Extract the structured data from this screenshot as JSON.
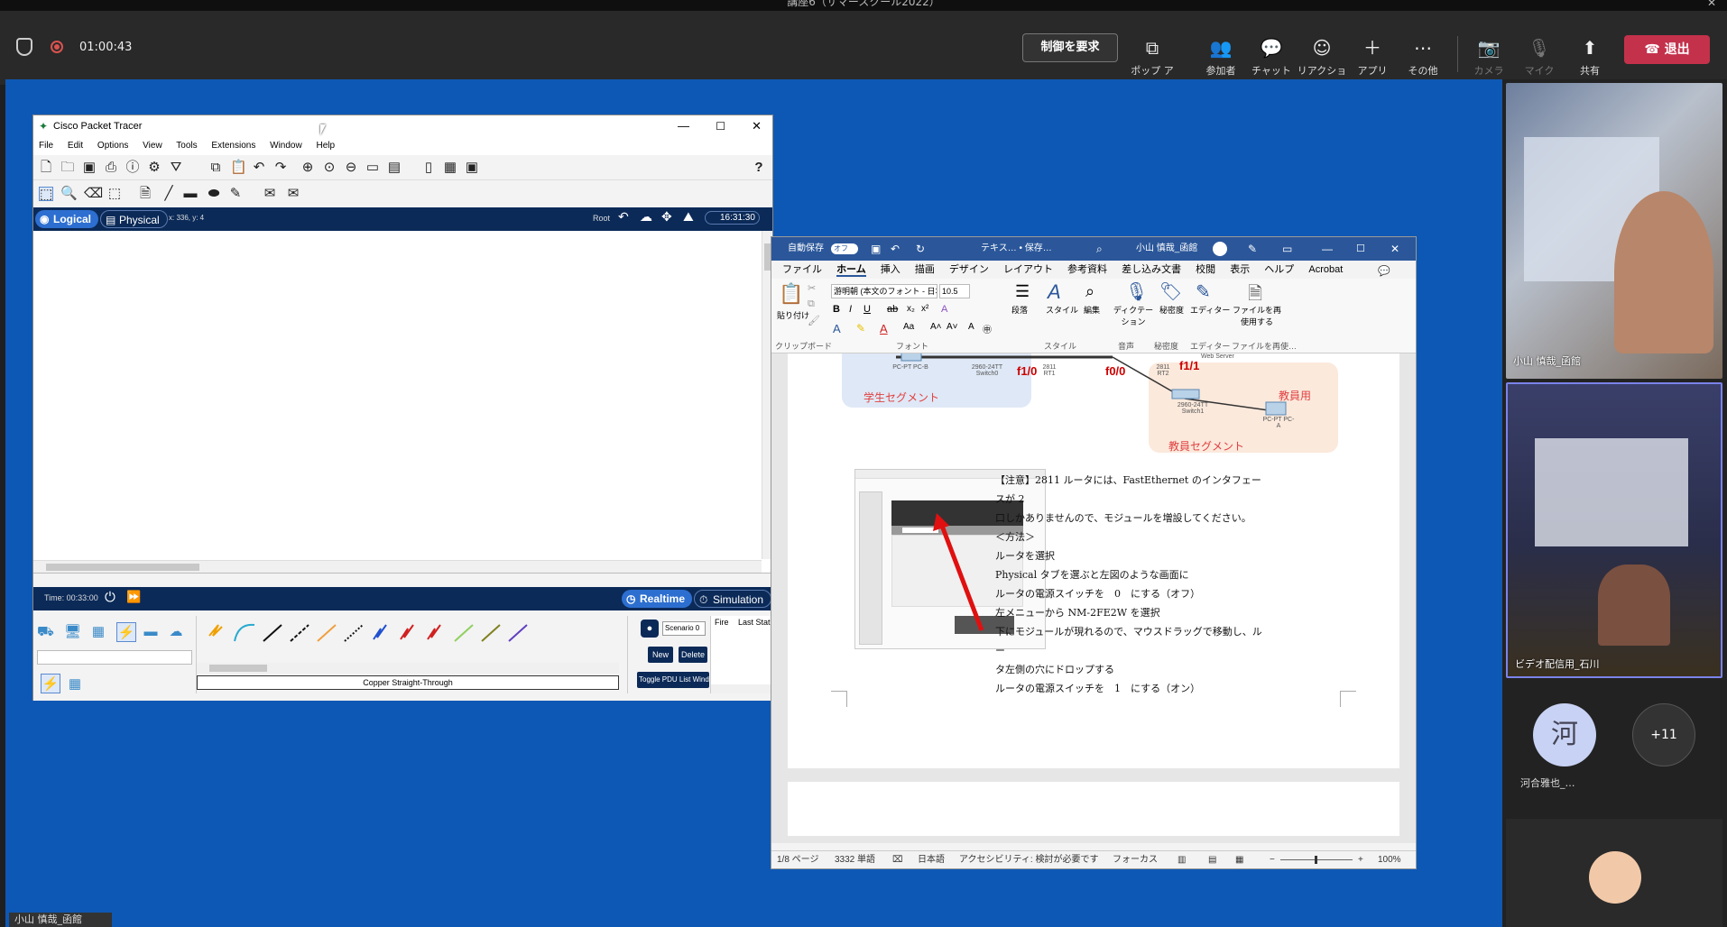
{
  "window_title": "講座6（サマースクール2022）",
  "teams": {
    "timer": "01:00:43",
    "request_control": "制御を要求",
    "buttons": [
      {
        "label": "ポップ アウト",
        "icon": "popout-icon"
      },
      {
        "label": "参加者",
        "icon": "people-icon"
      },
      {
        "label": "チャット",
        "icon": "chat-icon"
      },
      {
        "label": "リアクション",
        "icon": "reaction-icon"
      },
      {
        "label": "アプリ",
        "icon": "plus-icon"
      },
      {
        "label": "その他",
        "icon": "more-icon"
      },
      {
        "label": "カメラ",
        "icon": "camera-off-icon"
      },
      {
        "label": "マイク",
        "icon": "mic-off-icon"
      },
      {
        "label": "共有",
        "icon": "share-icon"
      }
    ],
    "leave": "退出",
    "bottom_label": "小山 慎哉_函館"
  },
  "participants": {
    "tile1_name": "小山 慎哉_函館",
    "tile2_name": "ビデオ配信用_石川",
    "avatar_initial": "河",
    "avatar_name": "河合雅也_…",
    "more_count": "+11"
  },
  "packet_tracer": {
    "title": "Cisco Packet Tracer",
    "menu": [
      "File",
      "Edit",
      "Options",
      "View",
      "Tools",
      "Extensions",
      "Window",
      "Help"
    ],
    "logical": "Logical",
    "physical": "Physical",
    "coords": "x: 336, y: 4",
    "root": "Root",
    "clock": "16:31:30",
    "time": "Time: 00:33:00",
    "realtime": "Realtime",
    "simulation": "Simulation",
    "scenario": "Scenario 0",
    "new": "New",
    "delete": "Delete",
    "toggle_pdu": "Toggle PDU List Window",
    "fire": "Fire",
    "last_status": "Last Status",
    "cable_label": "Copper Straight-Through",
    "help": "?"
  },
  "word": {
    "autosave": "自動保存",
    "autosave_state": "オフ",
    "doc_name": "テキス… • 保存…",
    "user": "小山 慎哉_函館",
    "tabs": [
      "ファイル",
      "ホーム",
      "挿入",
      "描画",
      "デザイン",
      "レイアウト",
      "参考資料",
      "差し込み文書",
      "校閲",
      "表示",
      "ヘルプ",
      "Acrobat"
    ],
    "font_name": "游明朝 (本文のフォント - 日本",
    "font_size": "10.5",
    "groups": [
      "クリップボード",
      "フォント",
      "スタイル",
      "音声",
      "秘密度",
      "エディター",
      "ファイルを再使…"
    ],
    "ribbon_buttons": [
      "貼り付け",
      "段落",
      "スタイル",
      "編集",
      "ディクテーション",
      "秘密度",
      "エディター",
      "ファイルを再使用する"
    ],
    "diagram": {
      "pc_b": "PC-PT PC-B",
      "switch0": "2960-24TT Switch0",
      "rt1": "2811 RT1",
      "rt2": "2811 RT2",
      "f10": "f1/0",
      "f00": "f0/0",
      "f11": "f1/1",
      "web": "Web Server",
      "switch1": "2960-24TT Switch1",
      "pc_a": "PC-PT PC-A",
      "student_seg": "学生セグメント",
      "teacher_label": "教員用",
      "teacher_seg": "教員セグメント"
    },
    "body_lines": [
      "【注意】2811 ルータには、FastEthernet のインタフェースが 2",
      "口しかありませんので、モジュールを増設してください。",
      "＜方法＞",
      "ルータを選択",
      "Physical タブを選ぶと左図のような画面に",
      "ルータの電源スイッチを　0　にする（オフ）",
      "左メニューから NM-2FE2W を選択",
      "下にモジュールが現れるので、マウスドラッグで移動し、ルー",
      "タ左側の穴にドロップする",
      "ルータの電源スイッチを　1　にする（オン）"
    ],
    "status": {
      "page": "1/8 ページ",
      "words": "3332 単語",
      "lang": "日本語",
      "access": "アクセシビリティ: 検討が必要です",
      "focus": "フォーカス",
      "zoom": "100%"
    }
  },
  "colors": {
    "leave": "#c4314b",
    "stage": "#0d58b4",
    "word": "#2b579a",
    "pt_nav": "#0b2a58"
  }
}
